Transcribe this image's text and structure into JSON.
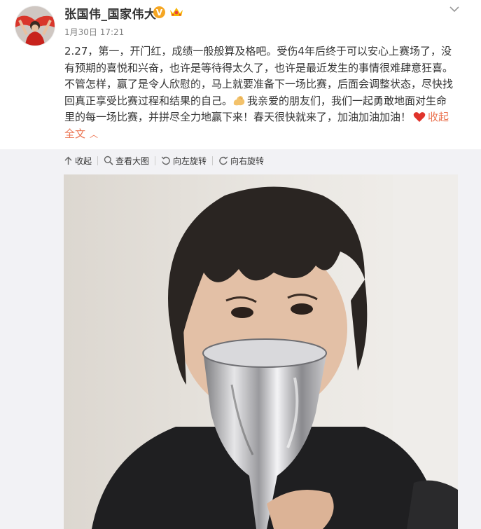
{
  "post": {
    "username": "张国伟_国家伟大",
    "verified_badge": "V",
    "time": "1月30日 17:21",
    "text_main": "2.27，第一，开门红，成绩一般般算及格吧。受伤4年后终于可以安心上赛场了，没有预期的喜悦和兴奋，也许是等待得太久了，也许是最近发生的事情很难肆意狂喜。不管怎样，赢了是令人欣慰的，马上就要准备下一场比赛，后面会调整状态，尽快找回真正享受比赛过程和结果的自己。",
    "text_tail": "我亲爱的朋友们，我们一起勇敢地面对生命里的每一场比赛，并拼尽全力地赢下来！春天很快就来了，加油加油加油！",
    "collapse_label": "收起全文",
    "icons": {
      "dropdown": "chevron-down-icon",
      "crown": "crown-badge-icon",
      "flex": "flexed-biceps-emoji",
      "heart": "red-heart-emoji"
    }
  },
  "toolbar": {
    "collapse": "收起",
    "view_large": "查看大图",
    "rotate_left": "向左旋转",
    "rotate_right": "向右旋转"
  },
  "colors": {
    "accent": "#eb7350",
    "verified": "#f5a623",
    "toolbar_bg": "#f2f2f5",
    "time": "#808080"
  }
}
